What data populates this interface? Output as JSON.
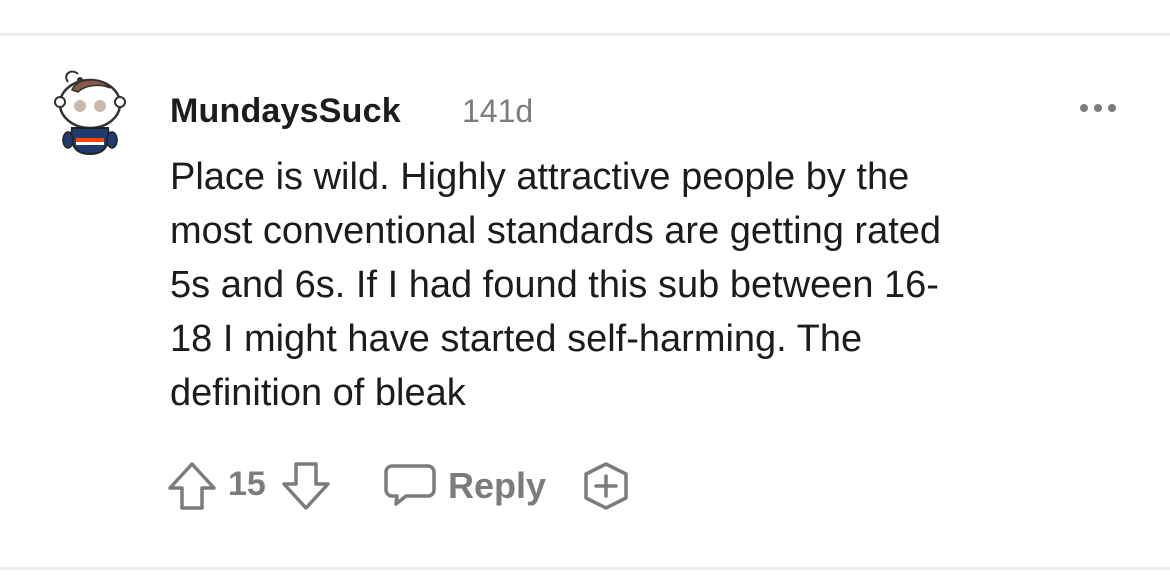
{
  "comment": {
    "author": "MundaysSuck",
    "age": "141d",
    "body_lines": [
      "Place is wild. Highly attractive people by the",
      "most conventional standards are getting rated",
      "5s and 6s. If I had found this sub between 16-",
      "18 I might have started self-harming. The",
      "definition of bleak"
    ],
    "score": "15",
    "reply_label": "Reply"
  },
  "icons": {
    "avatar": "snoo-avatar",
    "more": "more-options-icon",
    "upvote": "upvote-arrow-icon",
    "downvote": "downvote-arrow-icon",
    "reply": "speech-bubble-icon",
    "award": "award-plus-icon"
  },
  "colors": {
    "text": "#1c1c1c",
    "muted": "#7c7c7c",
    "divider": "#ededed"
  }
}
